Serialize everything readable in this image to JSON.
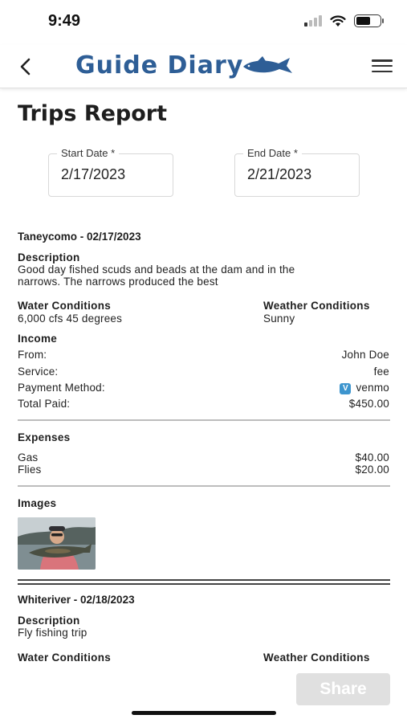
{
  "status_bar": {
    "time": "9:49"
  },
  "header": {
    "logo_text": "Guide Diary"
  },
  "page": {
    "title": "Trips Report"
  },
  "filters": {
    "start_label": "Start Date *",
    "start_value": "2/17/2023",
    "end_label": "End Date *",
    "end_value": "2/21/2023"
  },
  "labels": {
    "description": "Description",
    "water_conditions": "Water Conditions",
    "weather_conditions": "Weather Conditions",
    "income": "Income",
    "from": "From:",
    "service": "Service:",
    "payment_method": "Payment Method:",
    "total_paid": "Total Paid:",
    "expenses": "Expenses",
    "images": "Images"
  },
  "trips": [
    {
      "title": "Taneycomo  - 02/17/2023",
      "description_lines": [
        "Good day fished scuds and beads at the dam and in the",
        "narrows. The narrows produced the best"
      ],
      "water_conditions": "6,000 cfs 45 degrees",
      "weather_conditions": "Sunny",
      "income": {
        "from": "John Doe",
        "service": "fee",
        "payment_method": "venmo",
        "payment_badge": "V",
        "total_paid": "$450.00"
      },
      "expenses": [
        {
          "name": "Gas",
          "amount": "$40.00"
        },
        {
          "name": "Flies",
          "amount": "$20.00"
        }
      ]
    },
    {
      "title": "Whiteriver - 02/18/2023",
      "description_lines": [
        "Fly fishing trip"
      ]
    }
  ],
  "actions": {
    "share_label": "Share"
  },
  "colors": {
    "brand": "#2e5e96",
    "venmo": "#3d95ce",
    "share_disabled": "#e0e0e0"
  }
}
